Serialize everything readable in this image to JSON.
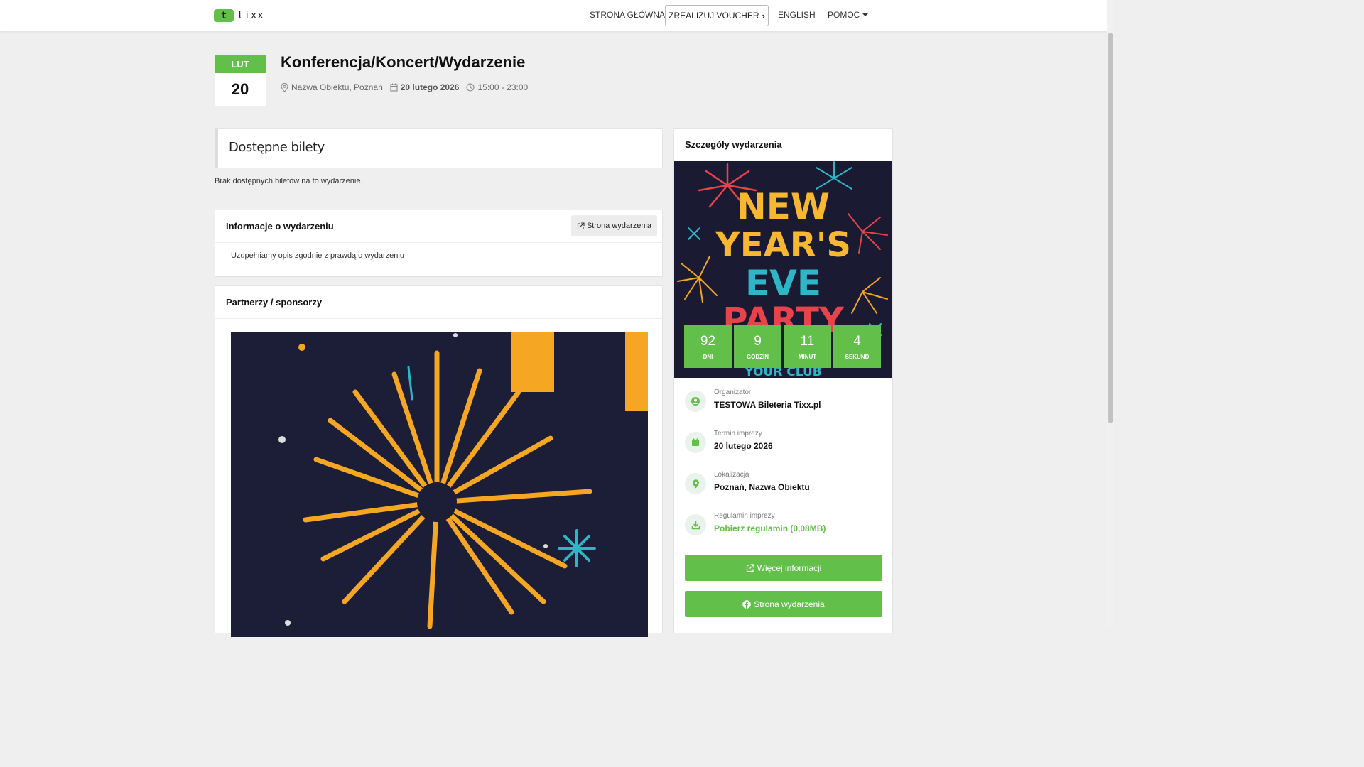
{
  "nav": {
    "logo_mark": "t",
    "logo_text": "tixx",
    "home": "STRONA GŁÓWNA",
    "voucher": "ZREALIZUJ VOUCHER",
    "language": "ENGLISH",
    "help": "POMOC"
  },
  "event": {
    "month": "LUT",
    "day": "20",
    "title": "Konferencja/Koncert/Wydarzenie",
    "location": "Nazwa Obiektu, Poznań",
    "date": "20 lutego 2026",
    "time": "15:00 - 23:00"
  },
  "tickets": {
    "title": "Dostępne bilety",
    "empty_message": "Brak dostępnych biletów na to wydarzenie."
  },
  "info": {
    "title": "Informacje o wydarzeniu",
    "button": "Strona wydarzenia",
    "description": "Uzupełniamy opis zgodnie z prawdą o wydarzeniu"
  },
  "partners": {
    "title": "Partnerzy / sponsorzy"
  },
  "details": {
    "title": "Szczegóły wydarzenia",
    "poster": {
      "line1": "NEW",
      "line2": "YEAR'S",
      "line3": "EVE",
      "line4": "PARTY",
      "footer": "YOUR CLUB"
    },
    "countdown": [
      {
        "value": "92",
        "unit": "DNI"
      },
      {
        "value": "9",
        "unit": "GODZIN"
      },
      {
        "value": "11",
        "unit": "MINUT"
      },
      {
        "value": "4",
        "unit": "SEKUND"
      }
    ],
    "organizer_label": "Organizator",
    "organizer_value": "TESTOWA Bileteria Tixx.pl",
    "term_label": "Termin imprezy",
    "term_value": "20 lutego 2026",
    "location_label": "Lokalizacja",
    "location_value": "Poznań, Nazwa Obiektu",
    "rules_label": "Regulamin imprezy",
    "rules_value": "Pobierz regulamin (0,08MB)",
    "more_info_button": "Więcej informacji",
    "event_page_button": "Strona wydarzenia"
  },
  "colors": {
    "accent": "#62c04a",
    "background": "#efefef"
  }
}
